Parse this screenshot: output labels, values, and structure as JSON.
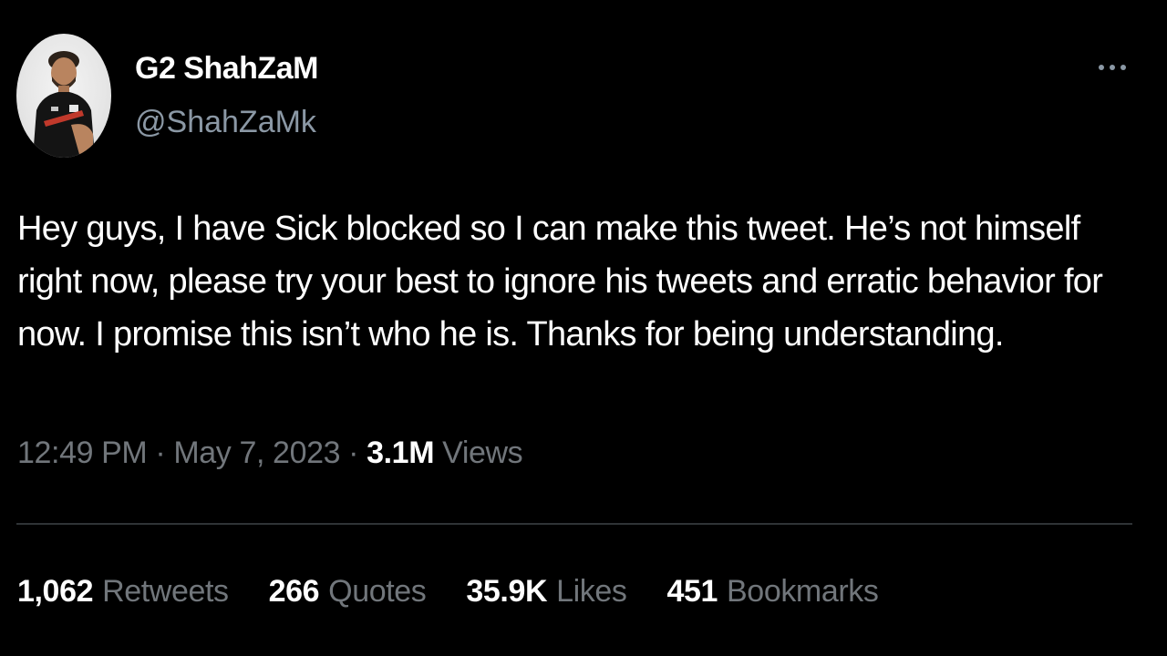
{
  "tweet": {
    "author": {
      "display_name": "G2 ShahZaM",
      "handle": "@ShahZaMk",
      "avatar_icon": "profile-photo"
    },
    "more_icon": "more-options-icon",
    "text": "Hey guys, I have Sick blocked so I can make this tweet. He’s not himself right now, please try your best to ignore his tweets and erratic behavior for now. I promise this isn’t who he is. Thanks for being understanding.",
    "time": "12:49 PM",
    "separator": "·",
    "date": "May 7, 2023",
    "views_count": "3.1M",
    "views_label": "Views"
  },
  "stats": {
    "retweets": {
      "count": "1,062",
      "label": "Retweets"
    },
    "quotes": {
      "count": "266",
      "label": "Quotes"
    },
    "likes": {
      "count": "35.9K",
      "label": "Likes"
    },
    "bookmarks": {
      "count": "451",
      "label": "Bookmarks"
    }
  },
  "colors": {
    "background": "#000000",
    "primary_text": "#ffffff",
    "secondary_text": "#71767b",
    "divider": "#2f3336"
  }
}
